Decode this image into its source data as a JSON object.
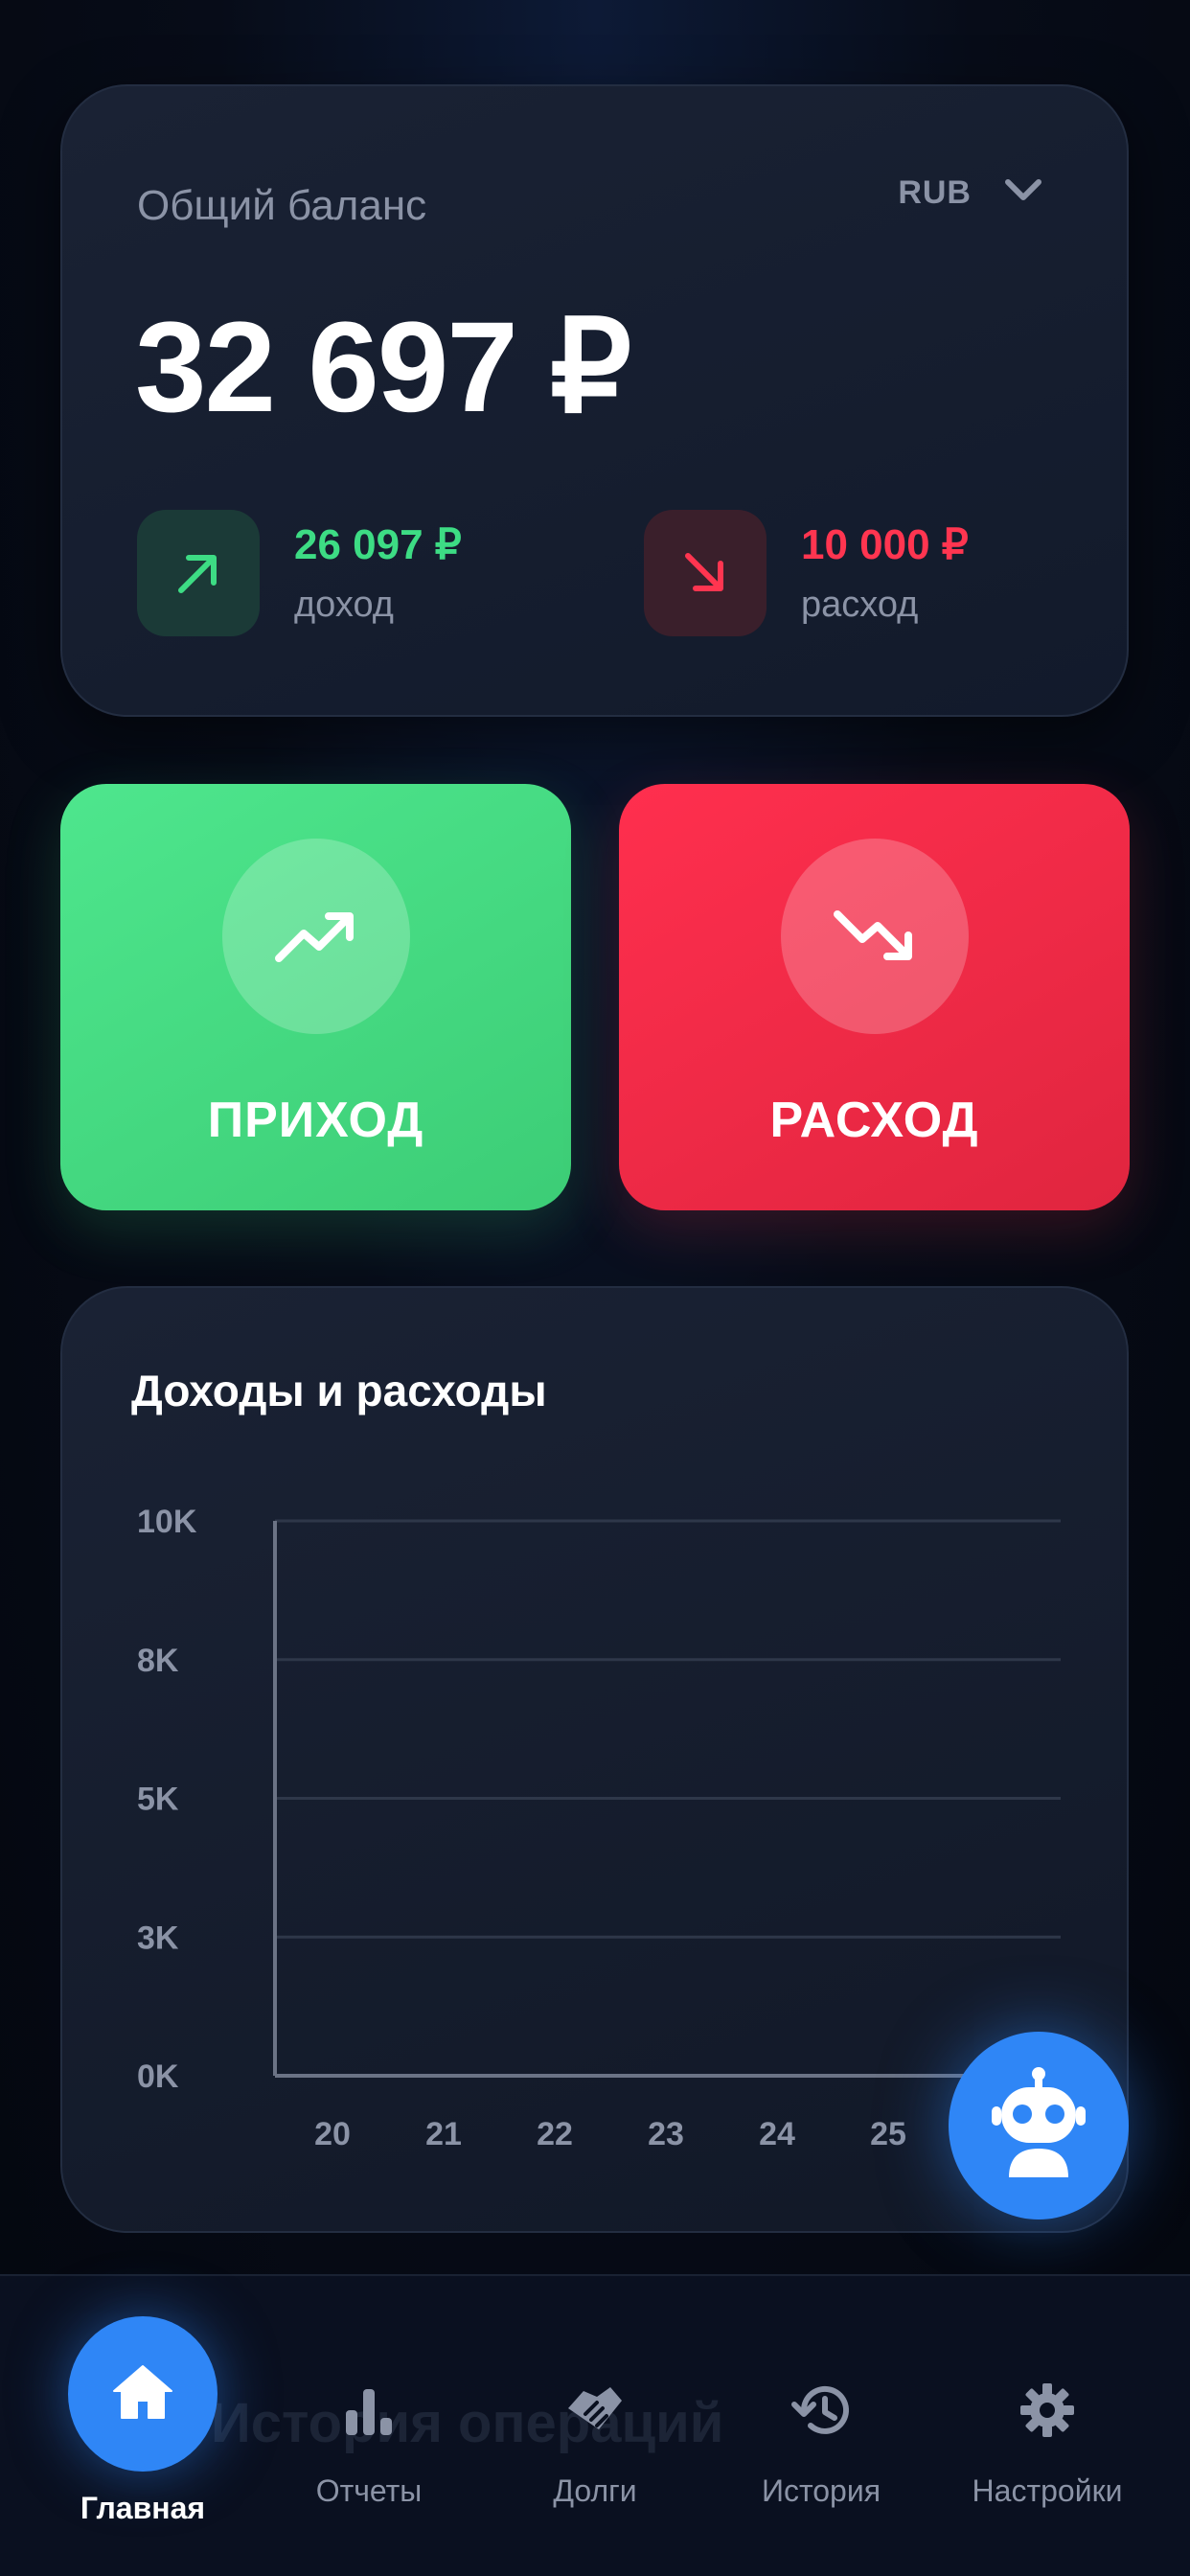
{
  "balance": {
    "label": "Общий баланс",
    "currency": "RUB",
    "amount": "32 697 ₽",
    "income": {
      "value": "26 097 ₽",
      "caption": "доход",
      "color": "#3ddc84"
    },
    "expense": {
      "value": "10 000 ₽",
      "caption": "расход",
      "color": "#ff3550"
    }
  },
  "actions": {
    "income_label": "ПРИХОД",
    "expense_label": "РАСХОД"
  },
  "chart_data": {
    "type": "bar",
    "title": "Доходы и расходы",
    "categories": [
      "20",
      "21",
      "22",
      "23",
      "24",
      "25"
    ],
    "series": [],
    "y_ticks": [
      "0K",
      "3K",
      "5K",
      "8K",
      "10K"
    ],
    "ylim": [
      0,
      10000
    ],
    "grid": true
  },
  "nav": {
    "ghost_text": "История операций",
    "items": [
      {
        "label": "Главная",
        "icon": "home-icon",
        "active": true
      },
      {
        "label": "Отчеты",
        "icon": "bar-chart-icon"
      },
      {
        "label": "Долги",
        "icon": "handshake-icon"
      },
      {
        "label": "История",
        "icon": "history-icon"
      },
      {
        "label": "Настройки",
        "icon": "gear-icon"
      }
    ]
  },
  "colors": {
    "accent": "#2f86f6",
    "income": "#3ddc84",
    "expense": "#ff3550"
  }
}
